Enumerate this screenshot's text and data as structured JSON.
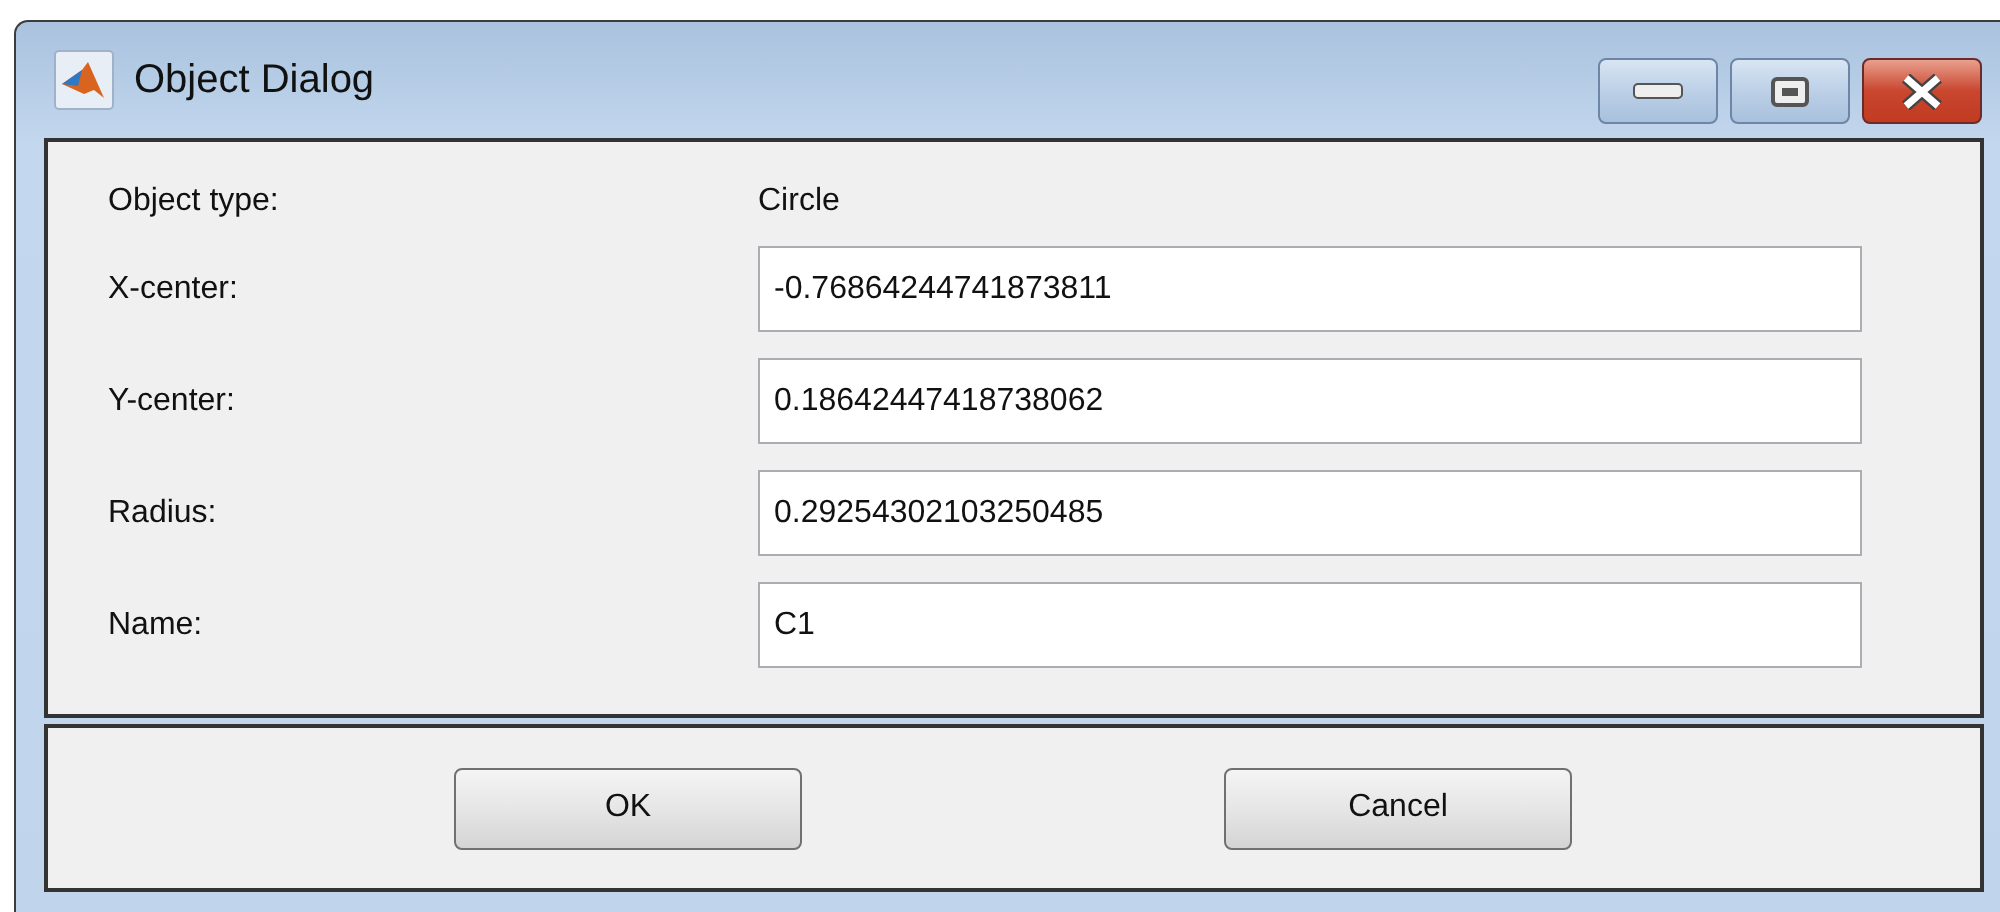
{
  "window": {
    "title": "Object Dialog"
  },
  "type_row": {
    "label": "Object type:",
    "value": "Circle"
  },
  "fields": [
    {
      "label": "X-center:",
      "value": "-0.76864244741873811"
    },
    {
      "label": "Y-center:",
      "value": "0.18642447418738062"
    },
    {
      "label": "Radius:",
      "value": "0.29254302103250485"
    },
    {
      "label": "Name:",
      "value": "C1"
    }
  ],
  "buttons": [
    "OK",
    "Cancel"
  ]
}
